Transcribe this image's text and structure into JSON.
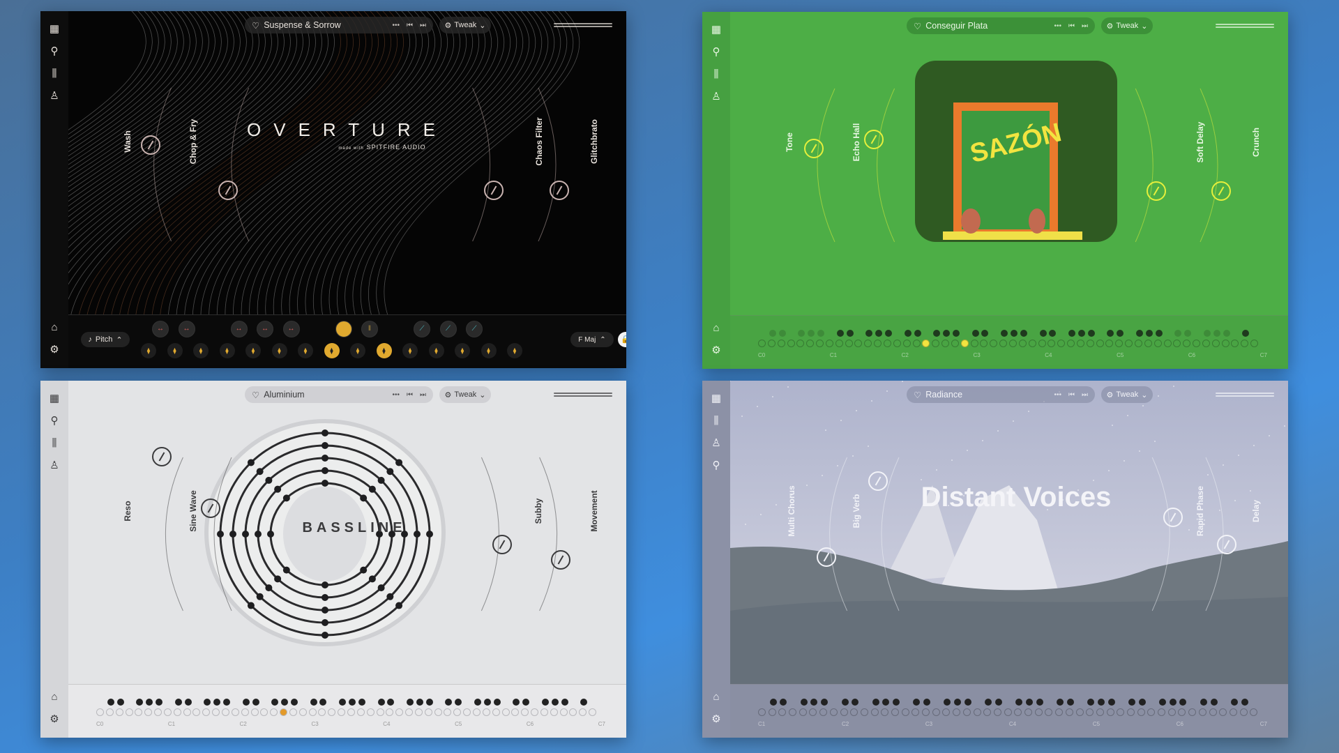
{
  "sidebar_icons_top": [
    "grid-icon",
    "search-icon",
    "library-icon",
    "user-icon"
  ],
  "sidebar_icons_bottom": [
    "learn-hat-icon",
    "settings-gear-icon"
  ],
  "panels": [
    {
      "id": "overture",
      "preset_name": "Suspense & Sorrow",
      "tweak_label": "Tweak",
      "title": "OVERTURE",
      "subtitle_prefix": "made with",
      "subtitle_brand": "SPITFIRE AUDIO",
      "knobs": [
        "Wash",
        "Chop & Fry",
        "Chaos Filter",
        "Glitchbrato"
      ],
      "bottom_bar": {
        "pitch_label": "Pitch",
        "key_label": "F Maj"
      },
      "colors": {
        "bg": "#050505",
        "sidebar": "#0d0d0d",
        "text": "#e8e2dc",
        "knob": "#c9b3b0",
        "accent": "#e0a92f",
        "teal": "#4fc0c8",
        "red": "#d8605c"
      }
    },
    {
      "id": "sazon",
      "preset_name": "Conseguir Plata",
      "tweak_label": "Tweak",
      "title": "SAZÓN",
      "knobs": [
        "Tone",
        "Echo Hall",
        "Soft Delay",
        "Crunch"
      ],
      "octave_labels": [
        "C0",
        "C1",
        "C2",
        "C3",
        "C4",
        "C5",
        "C6",
        "C7"
      ],
      "colors": {
        "bg": "#4dae46",
        "sidebar": "#46a041",
        "text": "#e9f7e4",
        "knob": "#e6f03c",
        "accent": "#f2e440",
        "frame": "#ea7a2c"
      }
    },
    {
      "id": "bassline",
      "preset_name": "Aluminium",
      "tweak_label": "Tweak",
      "title": "BASSLINE",
      "knobs": [
        "Reso",
        "Sine Wave",
        "Subby",
        "Movement"
      ],
      "octave_labels": [
        "C0",
        "C1",
        "C2",
        "C3",
        "C4",
        "C5",
        "C6",
        "C7"
      ],
      "colors": {
        "bg": "#e3e4e6",
        "sidebar": "#d5d6d9",
        "text": "#3a3a3c",
        "knob": "#3a3a3c",
        "accent": "#e39a2a"
      }
    },
    {
      "id": "radiance",
      "preset_name": "Radiance",
      "tweak_label": "Tweak",
      "title": "Distant Voices",
      "knobs": [
        "Multi Chorus",
        "Big Verb",
        "Rapid Phase",
        "Delay"
      ],
      "octave_labels": [
        "C1",
        "C2",
        "C3",
        "C4",
        "C5",
        "C6",
        "C7"
      ],
      "colors": {
        "bg": "#b9bdd4",
        "sidebar": "#8c91a6",
        "text": "#f2f3f8",
        "knob": "#f2f3f8",
        "accent": "#2a2a30",
        "grass": "#6f7880"
      }
    }
  ]
}
